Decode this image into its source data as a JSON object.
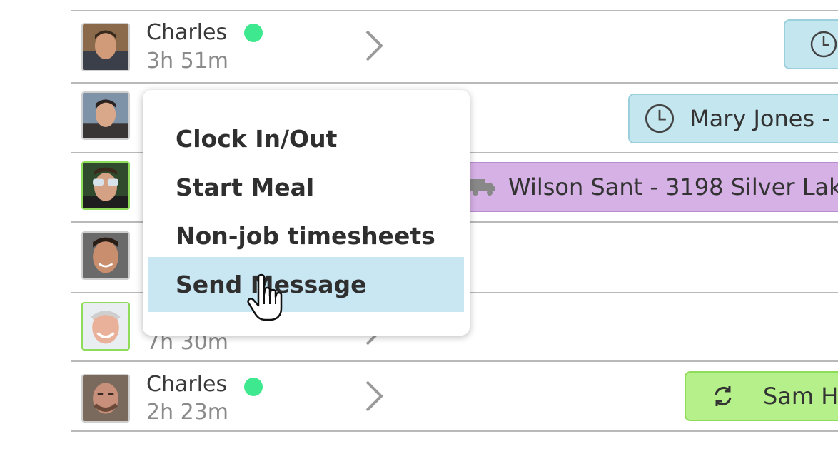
{
  "rows": [
    {
      "name": "Charles",
      "duration": "3h 51m",
      "online": true
    },
    {
      "name": "",
      "duration": "",
      "online": false
    },
    {
      "name": "",
      "duration": "",
      "online": false
    },
    {
      "name": "",
      "duration": "",
      "online": false
    },
    {
      "name": "",
      "duration": "7h 30m",
      "online": false
    },
    {
      "name": "Charles",
      "duration": "2h 23m",
      "online": true
    }
  ],
  "chips": {
    "row2": {
      "label": "Mary Jones -",
      "icon": "clock-icon",
      "color": "#c4e6ef"
    },
    "row3": {
      "label": "Wilson Sant - 3198 Silver Lak",
      "icon": "truck-icon",
      "color": "#d6b1e6"
    },
    "row6": {
      "label": "Sam H",
      "icon": "sync-icon",
      "color": "#b6f08a"
    }
  },
  "context_menu": {
    "items": [
      "Clock In/Out",
      "Start Meal",
      "Non-job timesheets",
      "Send Message"
    ],
    "highlighted": "Send Message"
  },
  "colors": {
    "online": "#3ee88e",
    "menu_highlight": "#c9e7f3"
  }
}
